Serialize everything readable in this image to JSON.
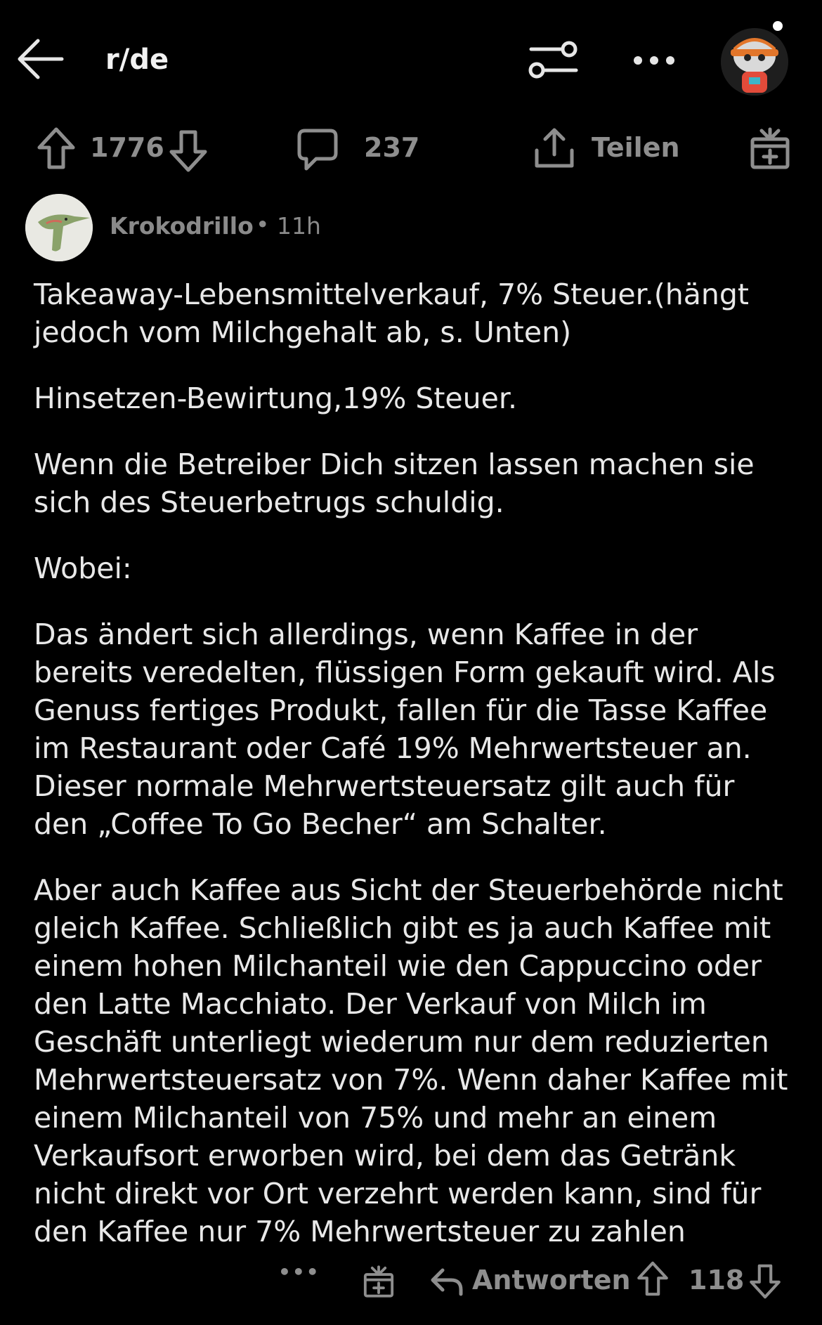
{
  "header": {
    "back_icon": "arrow-left-icon",
    "subreddit": "r/de",
    "filter_icon": "sliders-icon",
    "more_icon": "more-horizontal-icon",
    "avatar_icon": "snoo-avatar"
  },
  "post_actions": {
    "upvote_count": "1776",
    "comment_count": "237",
    "share_label": "Teilen"
  },
  "comment": {
    "author": "Krokodrillo",
    "separator": "•",
    "age": "11h",
    "paragraphs": [
      "Takeaway-Lebensmittelverkauf, 7% Steuer.(hängt\njedoch vom Milchgehalt ab, s. Unten)",
      "Hinsetzen-Bewirtung,19% Steuer.",
      "Wenn die Betreiber Dich sitzen lassen machen sie\nsich des Steuerbetrugs schuldig.",
      "Wobei:",
      "Das ändert sich allerdings, wenn Kaffee in der\nbereits veredelten, flüssigen Form gekauft wird. Als\nGenuss fertiges Produkt, fallen für die Tasse Kaffee\nim Restaurant oder Café 19% Mehrwertsteuer an.\nDieser normale Mehrwertsteuersatz gilt auch für\nden „Coffee To Go Becher“ am Schalter.",
      "Aber auch Kaffee aus Sicht der Steuerbehörde nicht\ngleich Kaffee. Schließlich gibt es ja auch Kaffee mit\neinem hohen Milchanteil wie den Cappuccino oder\nden Latte Macchiato. Der Verkauf von Milch im\nGeschäft unterliegt wiederum nur dem reduzierten\nMehrwertsteuersatz von 7%. Wenn daher Kaffee mit\neinem Milchanteil von 75% und mehr an einem\nVerkaufsort erworben wird, bei dem das Getränk\nnicht direkt vor Ort verzehrt werden kann, sind für\nden Kaffee nur 7% Mehrwertsteuer zu zahlen"
    ],
    "more_label": "•••",
    "reply_label": "Antworten",
    "vote_count": "118"
  },
  "colors": {
    "background": "#000000",
    "text": "#e8e8e8",
    "muted": "#8e8e8e"
  }
}
